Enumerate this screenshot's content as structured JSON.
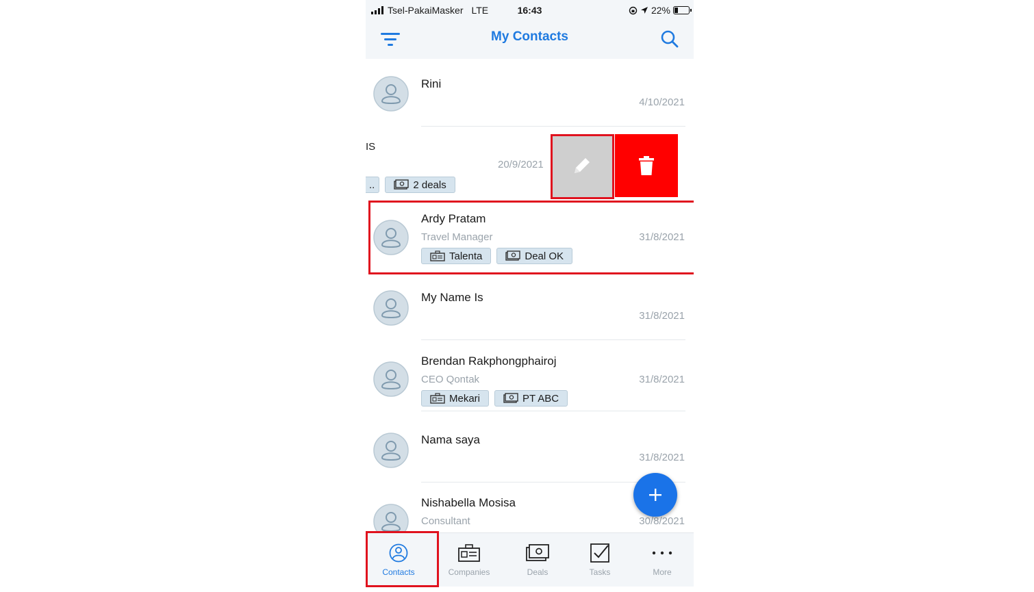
{
  "status_bar": {
    "carrier": "Tsel-PakaiMasker",
    "network": "LTE",
    "time": "16:43",
    "battery": "22%"
  },
  "header": {
    "title": "My Contacts"
  },
  "contacts": [
    {
      "name": "Rini",
      "subtitle": "",
      "date": "4/10/2021",
      "tags": []
    },
    {
      "name": "Ardy Pratam",
      "subtitle": "Travel Manager",
      "date": "31/8/2021",
      "tags": [
        {
          "type": "company",
          "label": "Talenta"
        },
        {
          "type": "deal",
          "label": "Deal OK"
        }
      ]
    },
    {
      "name": "My Name Is",
      "subtitle": "",
      "date": "31/8/2021",
      "tags": []
    },
    {
      "name": "Brendan Rakphongphairoj",
      "subtitle": "CEO Qontak",
      "date": "31/8/2021",
      "tags": [
        {
          "type": "company",
          "label": "Mekari"
        },
        {
          "type": "deal",
          "label": "PT ABC"
        }
      ]
    },
    {
      "name": "Nama saya",
      "subtitle": "",
      "date": "31/8/2021",
      "tags": []
    },
    {
      "name": "Nishabella Mosisa",
      "subtitle": "Consultant",
      "date": "30/8/2021",
      "tags": []
    }
  ],
  "swiped_row": {
    "name_fragment": "IS",
    "date": "20/9/2021",
    "tag_truncated": "..",
    "tag_deals": "2 deals"
  },
  "tabs": [
    {
      "label": "Contacts",
      "icon": "contacts-icon",
      "active": true
    },
    {
      "label": "Companies",
      "icon": "companies-icon",
      "active": false
    },
    {
      "label": "Deals",
      "icon": "deals-icon",
      "active": false
    },
    {
      "label": "Tasks",
      "icon": "tasks-icon",
      "active": false
    },
    {
      "label": "More",
      "icon": "more-icon",
      "active": false
    }
  ],
  "colors": {
    "accent": "#1f7ae0",
    "fab": "#1a73e8",
    "delete": "#ff0000",
    "edit": "#cfcfcf",
    "highlight": "#e0121e",
    "tag_bg": "#d6e4ee"
  }
}
